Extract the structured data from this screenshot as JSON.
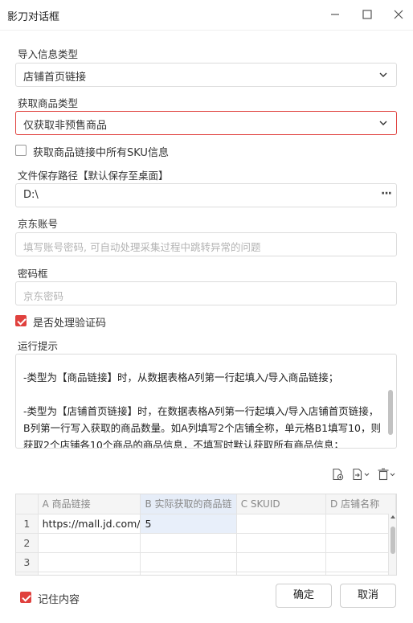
{
  "window": {
    "title": "影刀对话框"
  },
  "import_type": {
    "label": "导入信息类型",
    "value": "店铺首页链接"
  },
  "goods_type": {
    "label": "获取商品类型",
    "value": "仅获取非预售商品"
  },
  "sku_checkbox": {
    "label": "获取商品链接中所有SKU信息",
    "checked": false
  },
  "save_path": {
    "label": "文件保存路径【默认保存至桌面】",
    "value": "D:\\"
  },
  "jd_account": {
    "label": "京东账号",
    "placeholder": "填写账号密码, 可自动处理采集过程中跳转异常的问题"
  },
  "password": {
    "label": "密码框",
    "placeholder": "京东密码"
  },
  "captcha_checkbox": {
    "label": "是否处理验证码",
    "checked": true
  },
  "hint": {
    "label": "运行提示",
    "lines": [
      "-类型为【商品链接】时，从数据表格A列第一行起填入/导入商品链接；",
      "-类型为【店铺首页链接】时，在数据表格A列第一行起填入/导入店铺首页链接，B列第一行写入获取的商品数量。如A列填写2个店铺全称，单元格B1填写10，则获取2个店铺各10个商品的商品信息，不填写时默认获取所有商品信息；"
    ]
  },
  "table": {
    "columns": [
      "A 商品链接",
      "B 实际获取的商品链",
      "C SKUID",
      "D 店铺名称"
    ],
    "rows": [
      {
        "no": "1",
        "cells": [
          "https://mall.jd.com/",
          "5",
          "",
          ""
        ]
      },
      {
        "no": "2",
        "cells": [
          "",
          "",
          "",
          ""
        ]
      },
      {
        "no": "3",
        "cells": [
          "",
          "",
          "",
          ""
        ]
      },
      {
        "no": "",
        "cells": [
          "",
          "",
          "",
          ""
        ]
      }
    ]
  },
  "remember": {
    "label": "记住内容",
    "checked": true
  },
  "buttons": {
    "ok": "确定",
    "cancel": "取消"
  },
  "colors": {
    "accent": "#e0413e",
    "selected_col": "#e6edf8"
  }
}
